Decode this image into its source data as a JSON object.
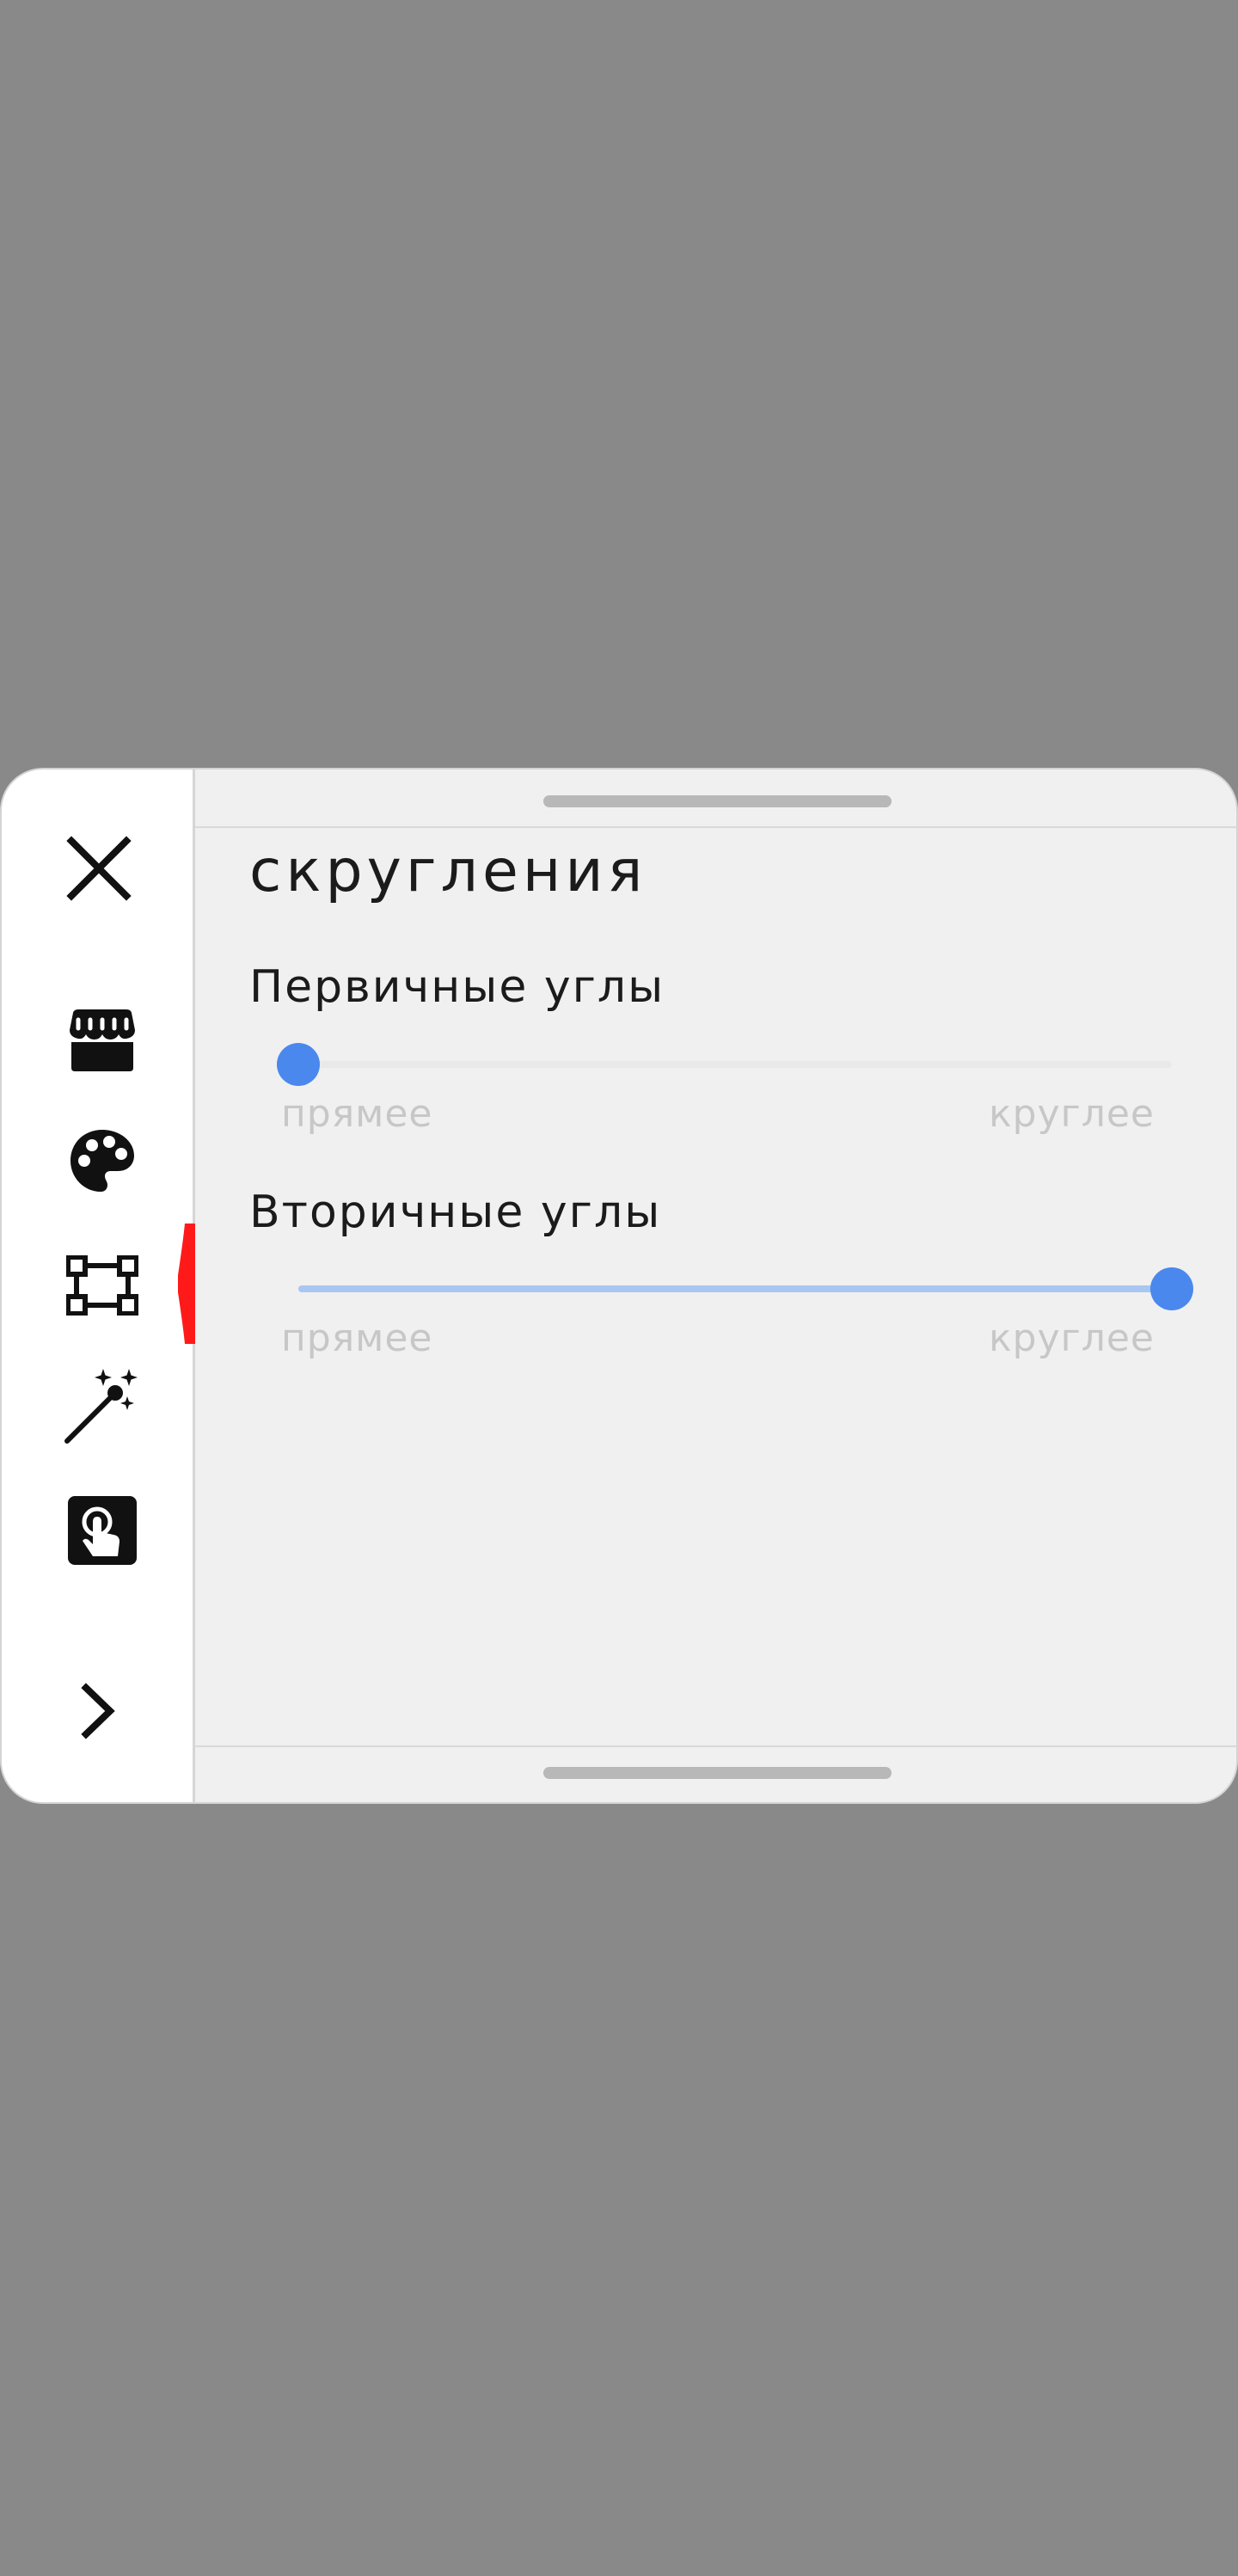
{
  "sidebar": {
    "icons": [
      "close-icon",
      "store-icon",
      "palette-icon",
      "vector-shape-icon",
      "magic-wand-icon",
      "touch-app-icon",
      "chevron-right-icon"
    ],
    "active_item": "vector-shape-icon",
    "active_marker_color": "#ff1a1a"
  },
  "panel": {
    "title": "скругления",
    "primary": {
      "label": "Первичные углы",
      "min_label": "прямее",
      "max_label": "круглее",
      "value": 0
    },
    "secondary": {
      "label": "Вторичные углы",
      "min_label": "прямее",
      "max_label": "круглее",
      "value": 1
    }
  },
  "colors": {
    "accent": "#4a88ee",
    "track_fill": "#a9c6f2",
    "backdrop": "#898989"
  }
}
